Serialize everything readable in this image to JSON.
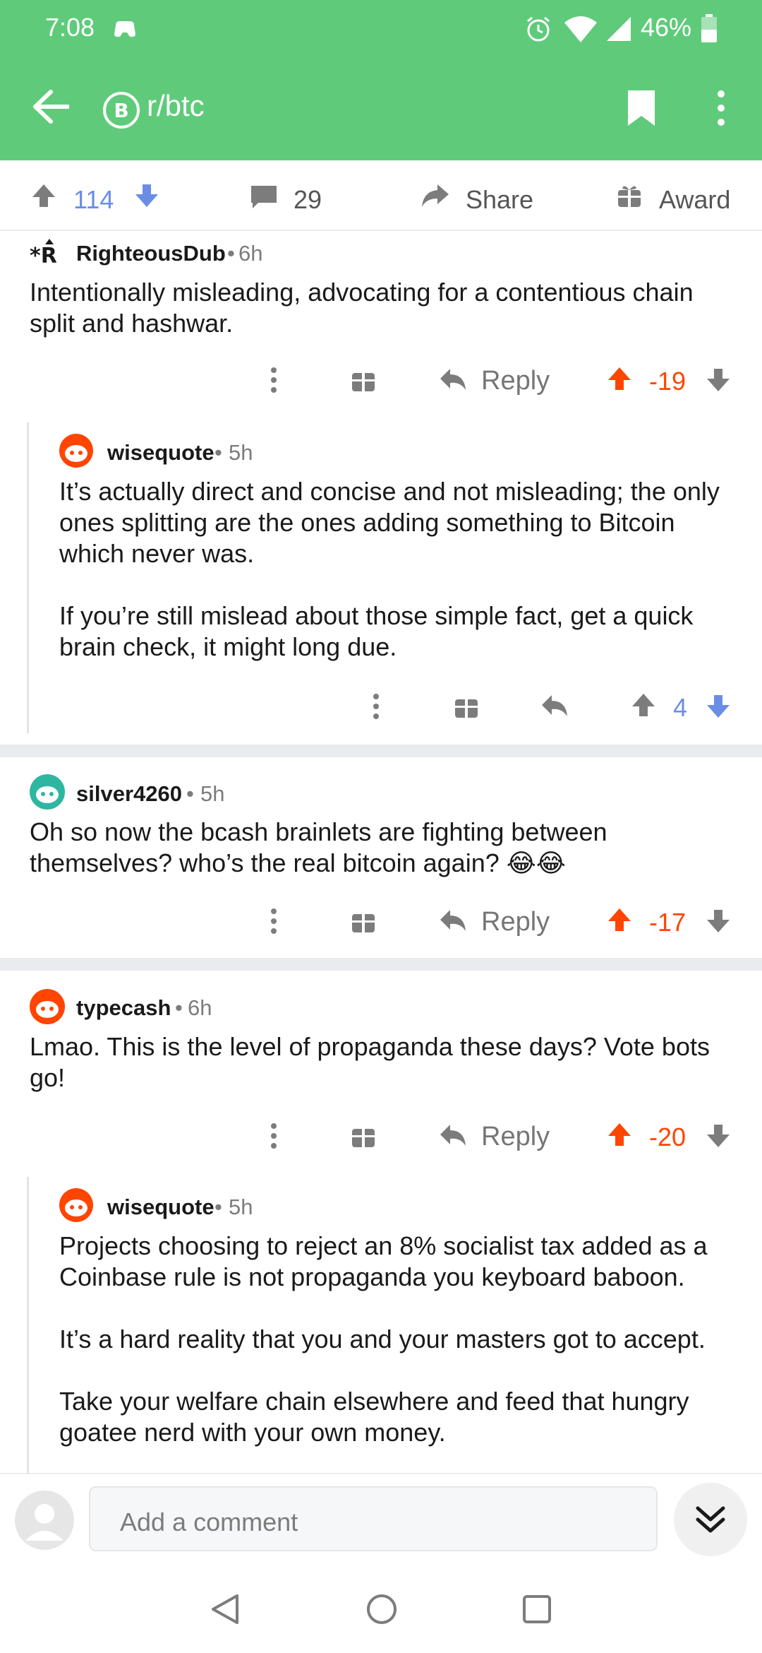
{
  "status_bar": {
    "time": "7:08",
    "battery": "46%"
  },
  "app_bar": {
    "title": "r/btc"
  },
  "post_actions": {
    "upvotes": "114",
    "comments": "29",
    "share": "Share",
    "award": "Award"
  },
  "comments": [
    {
      "author": "RighteousDub",
      "age": "6h",
      "text": "Intentionally misleading, advocating for a contentious chain\nsplit and hashwar.",
      "reply": "Reply",
      "score": "-19"
    },
    {
      "author": "wisequote",
      "age": "5h",
      "text": "It’s actually direct and concise and not misleading; the only\nones splitting are the ones adding something to Bitcoin\nwhich never was.\n\nIf you’re still mislead about those simple fact, get a quick\nbrain check, it might long due.",
      "score": "4"
    },
    {
      "author": "silver4260",
      "age": "5h",
      "text": "Oh so now the bcash brainlets are fighting between\nthemselves? who’s the real bitcoin again? 😂😂",
      "reply": "Reply",
      "score": "-17"
    },
    {
      "author": "typecash",
      "age": "6h",
      "text": "Lmao. This is the level of propaganda these days? Vote bots\ngo!",
      "reply": "Reply",
      "score": "-20"
    },
    {
      "author": "wisequote",
      "age": "5h",
      "text": "Projects choosing to reject an 8% socialist tax added as a\nCoinbase rule is not propaganda you keyboard baboon.\n\nIt’s a hard reality that you and your masters got to accept.\n\nTake your welfare chain elsewhere and feed that hungry\ngoatee nerd with your own money."
    }
  ],
  "composer": {
    "placeholder": "Add a comment"
  },
  "colors": {
    "header": "#5fcb7a",
    "downvoted": "#ff4500",
    "upvoted": "#6a8ee6"
  }
}
